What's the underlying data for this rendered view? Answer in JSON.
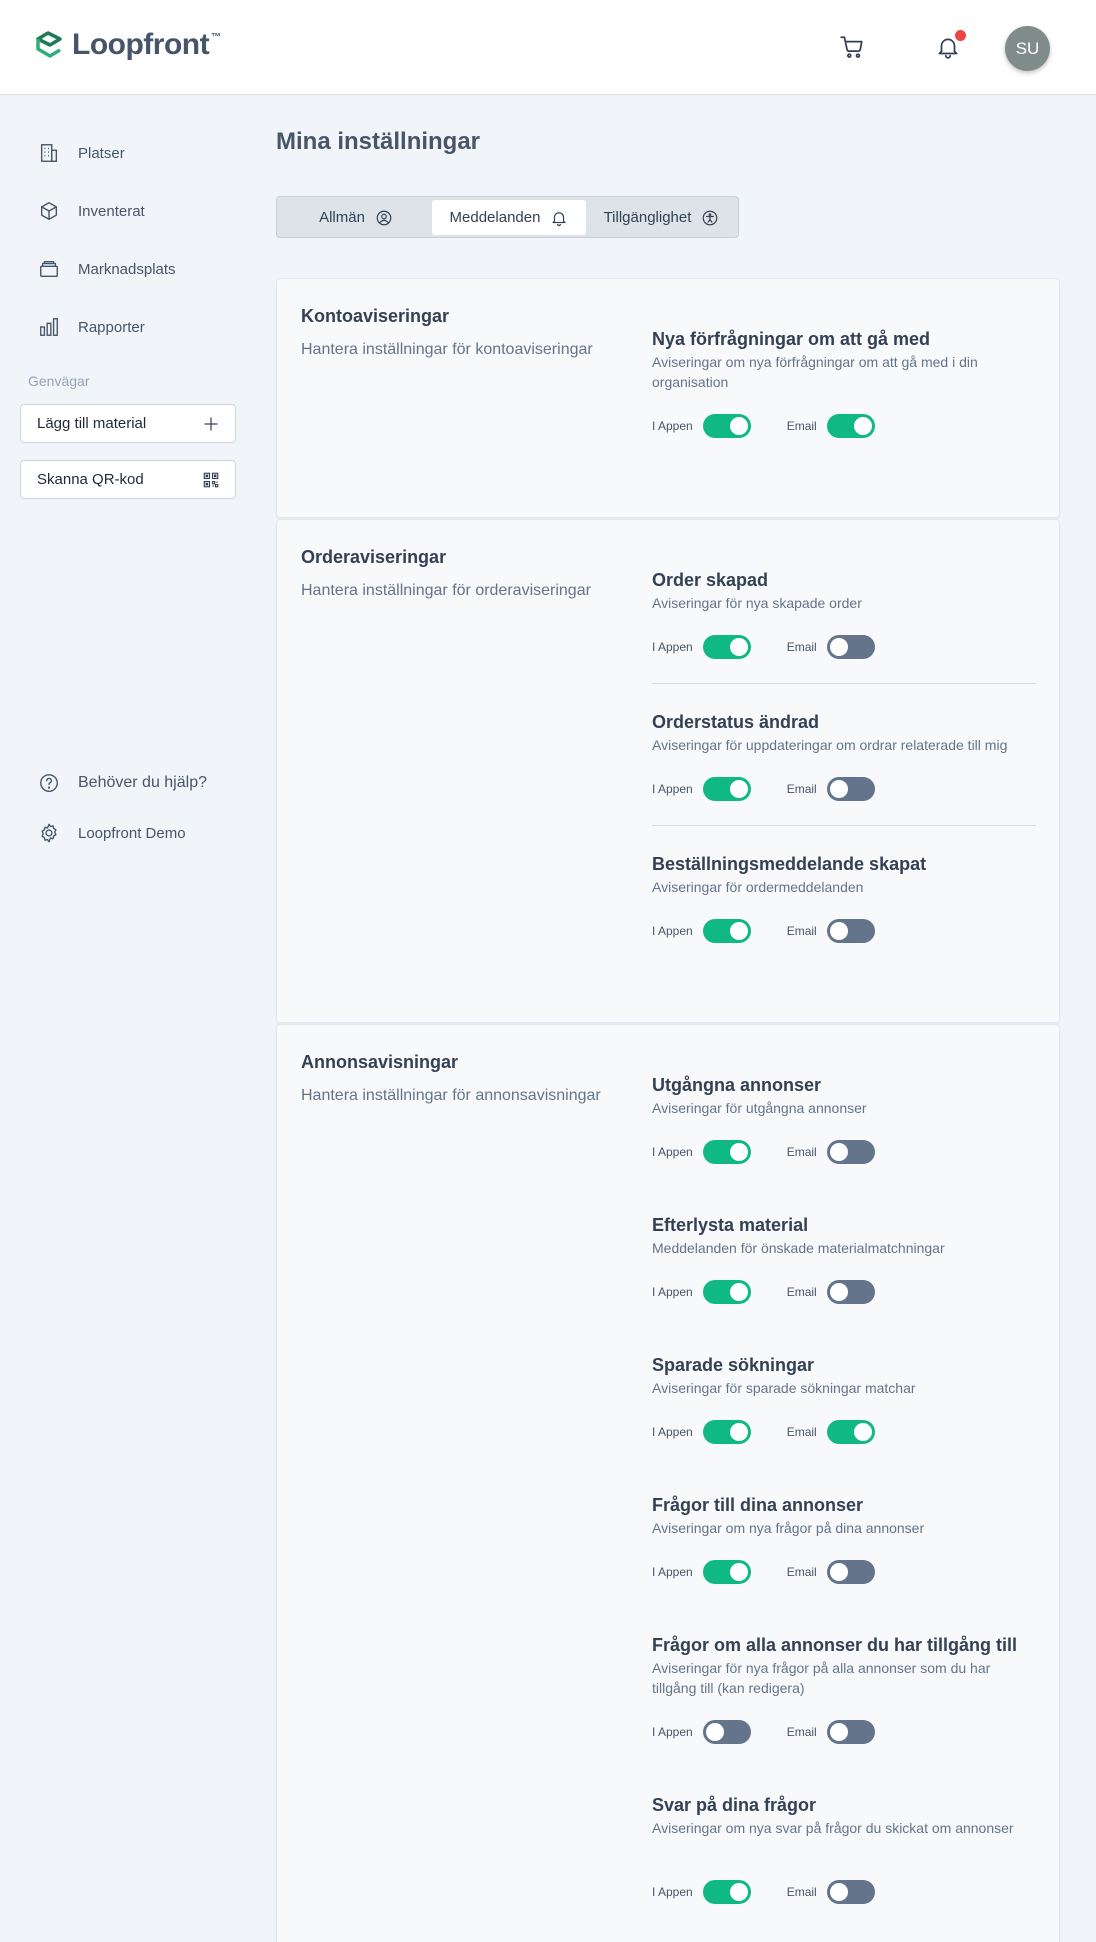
{
  "header": {
    "logo_text": "Loopfront",
    "logo_tm": "™",
    "avatar_initials": "SU",
    "cart_icon": "cart-icon",
    "bell_icon": "bell-icon",
    "notification_dot_color": "#ef4444"
  },
  "sidebar": {
    "nav": [
      {
        "label": "Platser",
        "icon": "building-icon"
      },
      {
        "label": "Inventerat",
        "icon": "box-icon"
      },
      {
        "label": "Marknadsplats",
        "icon": "marketplace-icon"
      },
      {
        "label": "Rapporter",
        "icon": "bar-chart-icon"
      }
    ],
    "shortcuts_title": "Genvägar",
    "shortcuts": [
      {
        "label": "Lägg till material",
        "icon": "plus-icon"
      },
      {
        "label": "Skanna QR-kod",
        "icon": "qr-code-icon"
      }
    ],
    "help_label": "Behöver du hjälp?",
    "org_label": "Loopfront Demo"
  },
  "main": {
    "title": "Mina inställningar",
    "tabs": [
      {
        "label": "Allmän",
        "icon": "user-circle-icon",
        "active": false
      },
      {
        "label": "Meddelanden",
        "icon": "bell-icon",
        "active": true
      },
      {
        "label": "Tillgänglighet",
        "icon": "accessibility-icon",
        "active": false
      }
    ],
    "toggle_labels": {
      "in_app": "I Appen",
      "email": "Email"
    },
    "colors": {
      "toggle_on": "#10b981",
      "toggle_off": "#64748b"
    },
    "sections": [
      {
        "title": "Kontoaviseringar",
        "subtitle": "Hantera inställningar för kontoaviseringar",
        "settings": [
          {
            "title": "Nya förfrågningar om att gå med",
            "description": "Aviseringar om nya förfrågningar om att gå med i din organisation",
            "in_app": true,
            "email": true
          }
        ]
      },
      {
        "title": "Orderaviseringar",
        "subtitle": "Hantera inställningar för orderaviseringar",
        "settings": [
          {
            "title": "Order skapad",
            "description": "Aviseringar för nya skapade order",
            "in_app": true,
            "email": false
          },
          {
            "title": "Orderstatus ändrad",
            "description": "Aviseringar för uppdateringar om ordrar relaterade till mig",
            "in_app": true,
            "email": false
          },
          {
            "title": "Beställningsmeddelande skapat",
            "description": "Aviseringar för ordermeddelanden",
            "in_app": true,
            "email": false
          }
        ]
      },
      {
        "title": "Annonsavisningar",
        "subtitle": "Hantera inställningar för annonsavisningar",
        "settings": [
          {
            "title": "Utgångna annonser",
            "description": "Aviseringar för utgångna annonser",
            "in_app": true,
            "email": false
          },
          {
            "title": "Efterlysta material",
            "description": "Meddelanden för önskade materialmatchningar",
            "in_app": true,
            "email": false
          },
          {
            "title": "Sparade sökningar",
            "description": "Aviseringar för sparade sökningar matchar",
            "in_app": true,
            "email": true
          },
          {
            "title": "Frågor till dina annonser",
            "description": "Aviseringar om nya frågor på dina annonser",
            "in_app": true,
            "email": false
          },
          {
            "title": "Frågor om alla annonser du har tillgång till",
            "description": "Aviseringar för nya frågor på alla annonser som du har tillgång till (kan redigera)",
            "in_app": false,
            "email": false
          },
          {
            "title": "Svar på dina frågor",
            "description": "Aviseringar om nya svar på frågor du skickat om annonser",
            "in_app": true,
            "email": false
          }
        ]
      }
    ]
  }
}
